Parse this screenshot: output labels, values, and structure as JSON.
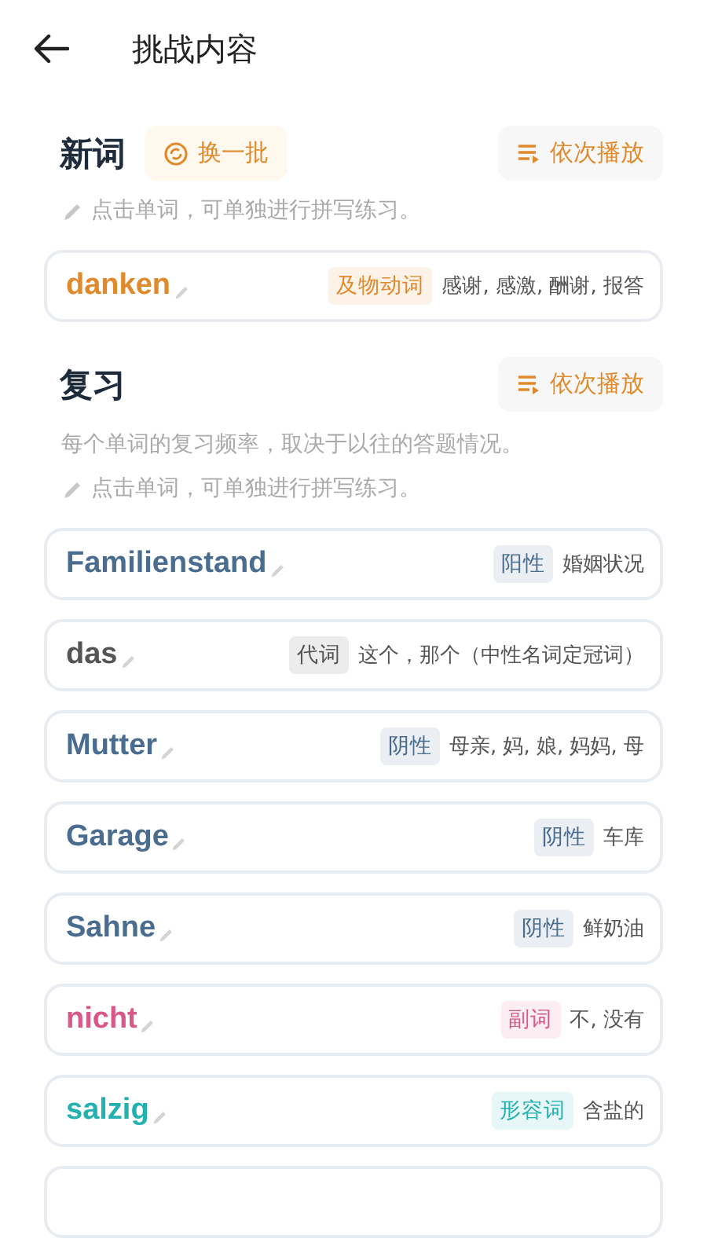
{
  "header": {
    "title": "挑战内容"
  },
  "new_words": {
    "title": "新词",
    "refresh_button": "换一批",
    "play_button": "依次播放",
    "hint": "点击单词，可单独进行拼写练习。",
    "words": [
      {
        "word": "danken",
        "tag": "及物动词",
        "meaning": "感谢, 感激, 酬谢, 报答",
        "color": "#e08a2c"
      }
    ]
  },
  "review": {
    "title": "复习",
    "play_button": "依次播放",
    "description": "每个单词的复习频率，取决于以往的答题情况。",
    "hint": "点击单词，可单独进行拼写练习。",
    "words": [
      {
        "word": "Familienstand",
        "tag": "阳性",
        "meaning": "婚姻状况",
        "color": "#4a6d8f"
      },
      {
        "word": "das",
        "tag": "代词",
        "meaning": "这个，那个（中性名词定冠词）",
        "color": "#555555"
      },
      {
        "word": "Mutter",
        "tag": "阴性",
        "meaning": "母亲, 妈, 娘, 妈妈, 母",
        "color": "#4a6d8f"
      },
      {
        "word": "Garage",
        "tag": "阴性",
        "meaning": "车库",
        "color": "#4a6d8f"
      },
      {
        "word": "Sahne",
        "tag": "阴性",
        "meaning": "鲜奶油",
        "color": "#4a6d8f"
      },
      {
        "word": "nicht",
        "tag": "副词",
        "meaning": "不, 没有",
        "color": "#d9588a"
      },
      {
        "word": "salzig",
        "tag": "形容词",
        "meaning": "含盐的",
        "color": "#22b0b0"
      }
    ]
  }
}
